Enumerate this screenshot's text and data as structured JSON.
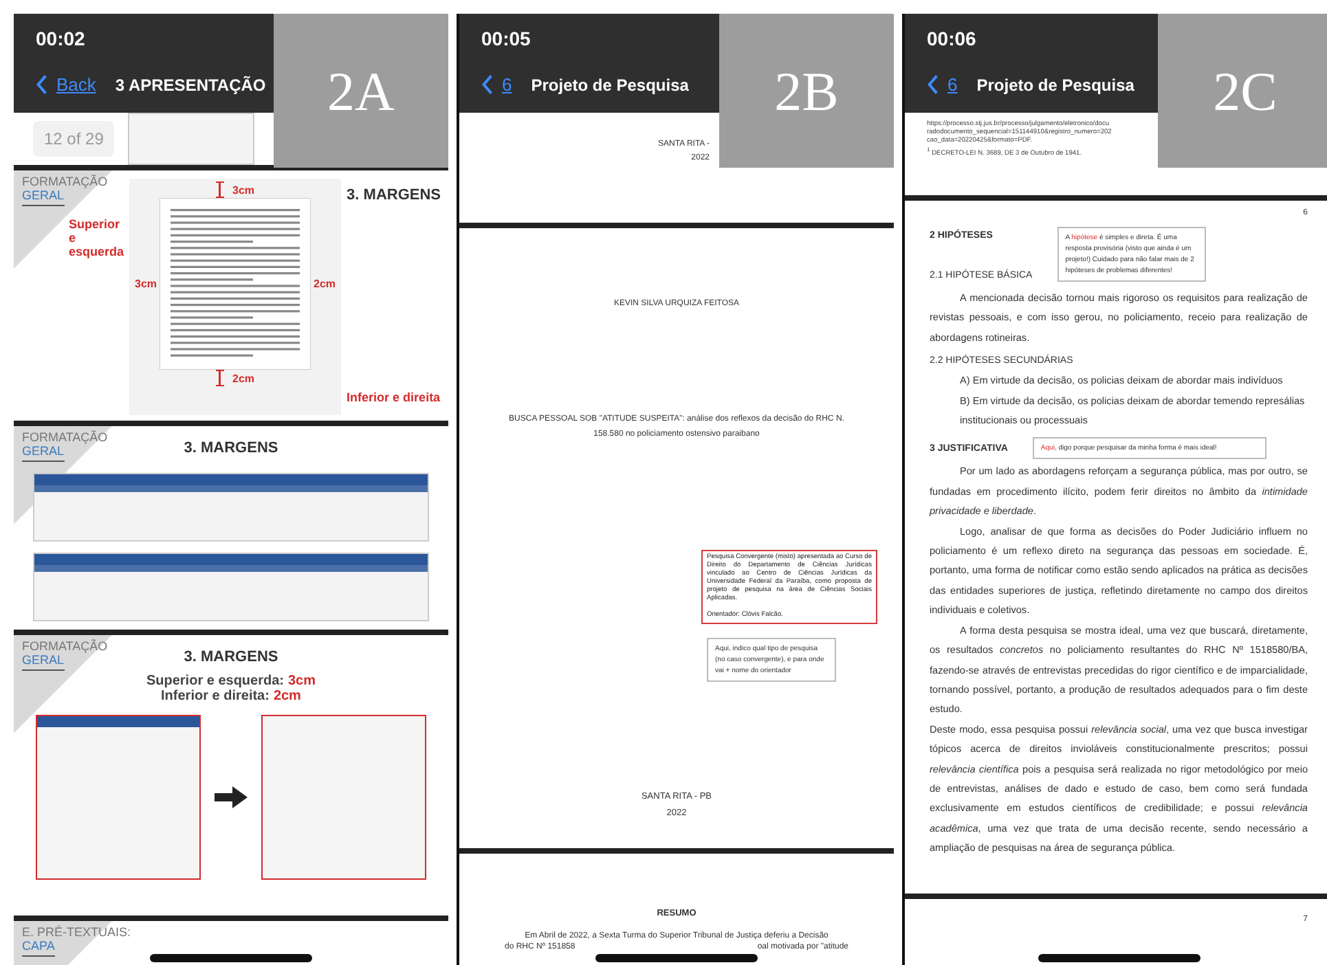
{
  "panels": [
    {
      "kind": "slides",
      "label": "2A",
      "time": "00:02",
      "back": "Back",
      "title": "3 APRESENTAÇÃO",
      "counter": "12 of 29",
      "slides": [
        {
          "kind": "margins-page",
          "corner": {
            "top": "FORMATAÇÃO",
            "bottom": "GERAL"
          },
          "title": "3. MARGENS",
          "top_mark": "3cm",
          "left_mark": "3cm",
          "right_mark": "2cm",
          "bottom_mark": "2cm",
          "top_note": "Superior e esquerda",
          "bottom_note": "Inferior e direita"
        },
        {
          "kind": "ribbons",
          "corner": {
            "top": "FORMATAÇÃO",
            "bottom": "GERAL"
          },
          "title": "3. MARGENS"
        },
        {
          "kind": "dialogs",
          "corner": {
            "top": "FORMATAÇÃO",
            "bottom": "GERAL"
          },
          "title": "3. MARGENS",
          "rules": [
            {
              "label": "Superior e esquerda:",
              "value": "3cm"
            },
            {
              "label": "Inferior e direita:",
              "value": "2cm"
            }
          ]
        },
        {
          "kind": "section",
          "corner": {
            "top": "E. PRÉ-TEXTUAIS:",
            "bottom": "CAPA"
          }
        }
      ]
    },
    {
      "kind": "document",
      "label": "2B",
      "time": "00:05",
      "back": "6",
      "title": "Projeto de Pesquisa",
      "pages": [
        {
          "kind": "tail",
          "lines": [
            "SANTA RITA -",
            "2022"
          ]
        },
        {
          "kind": "cover",
          "author": "KEVIN SILVA URQUIZA FEITOSA",
          "work_title": "BUSCA PESSOAL SOB \"ATITUDE SUSPEITA\": análise dos reflexos da decisão do RHC N. 158.580 no policiamento ostensivo paraibano",
          "affiliation": [
            "Pesquisa Convergente (misto) apresentada ao Curso de Direito do Departamento de Ciências Jurídicas vinculado ao Centro de Ciências Jurídicas da Universidade Federal da Paraíba, como proposta de projeto de pesquisa na área de Ciências Sociais Aplicadas.",
            "Orientador: Clóvis Falcão."
          ],
          "comment": "Aqui, indico qual tipo de pesquisa (no caso convergente), e para onde vai + nome do orientador",
          "city": "SANTA RITA - PB",
          "year": "2022"
        },
        {
          "kind": "abstract",
          "heading": "RESUMO",
          "first_line": "Em Abril de 2022, a Sexta Turma do Superior Tribunal de Justiça deferiu a Decisão",
          "cut_line": {
            "left": "do RHC Nº 151858",
            "right": "oal motivada por \"atitude"
          }
        }
      ]
    },
    {
      "kind": "document",
      "label": "2C",
      "time": "00:06",
      "back": "6",
      "title": "Projeto de Pesquisa",
      "pages": [
        {
          "kind": "notes",
          "lines": [
            "https://processo.stj.jus.br/processo/julgamento/eletronico/docu",
            "radodocumento_sequencial=151144910&registro_numero=202",
            "cao_data=20220425&formato=PDF."
          ],
          "footnote": "$^{1}$ DECRETO-LEI N. 3689, DE 3 de Outubro de 1941."
        },
        {
          "kind": "body",
          "number": "6",
          "blocks": [
            {
              "kind": "annotated",
              "headings": [
                {
                  "text": "2 HIPÓTESES",
                  "bold": true
                },
                {
                  "text": "2.1 HIPÓTESE BÁSICA",
                  "bold": false
                }
              ],
              "comment": [
                {
                  "text": "A ",
                  "highlight": false
                },
                {
                  "text": "hipótese",
                  "highlight": true
                },
                {
                  "text": " é simples e direta. É uma resposta provisória (visto que ainda é um projeto!) Cuidado para não falar mais de 2 hipóteses de problemas diferentes!",
                  "highlight": false
                }
              ]
            },
            {
              "kind": "paragraph",
              "indent": true,
              "text": "A mencionada decisão tornou mais rigoroso os requisitos para realização de revistas pessoais, e com isso gerou, no policiamento, receio para realização de abordagens rotineiras."
            },
            {
              "kind": "heading",
              "bold": false,
              "text": "2.2 HIPÓTESES SECUNDÁRIAS"
            },
            {
              "kind": "list-item",
              "text": "A) Em virtude da decisão, os policias deixam de abordar mais indivíduos"
            },
            {
              "kind": "list-item",
              "text": "B) Em virtude da decisão, os policias deixam de abordar temendo represálias institucionais ou  processuais"
            },
            {
              "kind": "annotated",
              "headings": [
                {
                  "text": "3 JUSTIFICATIVA",
                  "bold": true
                }
              ],
              "comment": [
                {
                  "text": "Aqui",
                  "highlight": true
                },
                {
                  "text": ", digo porque pesquisar da minha forma é mais ideal!",
                  "highlight": false
                }
              ]
            },
            {
              "kind": "paragraph",
              "indent": true,
              "text": "Por um lado as abordagens reforçam a segurança pública, mas por outro, se fundadas em procedimento ilícito, podem ferir direitos no âmbito da *intimidade privacidade e liberdade*."
            },
            {
              "kind": "paragraph",
              "indent": true,
              "text": "Logo, analisar de que forma as decisões do Poder Judiciário influem no policiamento é um reflexo direto na segurança das pessoas em sociedade. É, portanto, uma forma de notificar como estão sendo aplicados na prática as decisões das entidades superiores de justiça, refletindo diretamente no campo dos direitos individuais e coletivos."
            },
            {
              "kind": "paragraph",
              "indent": true,
              "text": "A forma desta pesquisa se mostra ideal, uma vez que buscará, diretamente, os resultados *concretos* no policiamento resultantes do RHC Nº 1518580/BA, fazendo-se através de entrevistas precedidas do rigor científico e de imparcialidade, tornando possível, portanto, a produção de resultados adequados para o fim deste estudo."
            },
            {
              "kind": "paragraph",
              "indent": false,
              "text": "Deste modo, essa pesquisa possui *relevância social*, uma vez que busca investigar tópicos acerca de direitos invioláveis constitucionalmente prescritos; possui *relevância científica* pois a pesquisa será realizada no rigor metodológico por meio de entrevistas, análises de dado e estudo de caso, bem como será fundada exclusivamente em estudos científicos de credibilidade; e possui *relevância acadêmica*, uma vez que trata de uma decisão recente, sendo necessário a ampliação de pesquisas na área de segurança pública."
            }
          ]
        },
        {
          "kind": "next",
          "number": "7"
        }
      ]
    }
  ]
}
